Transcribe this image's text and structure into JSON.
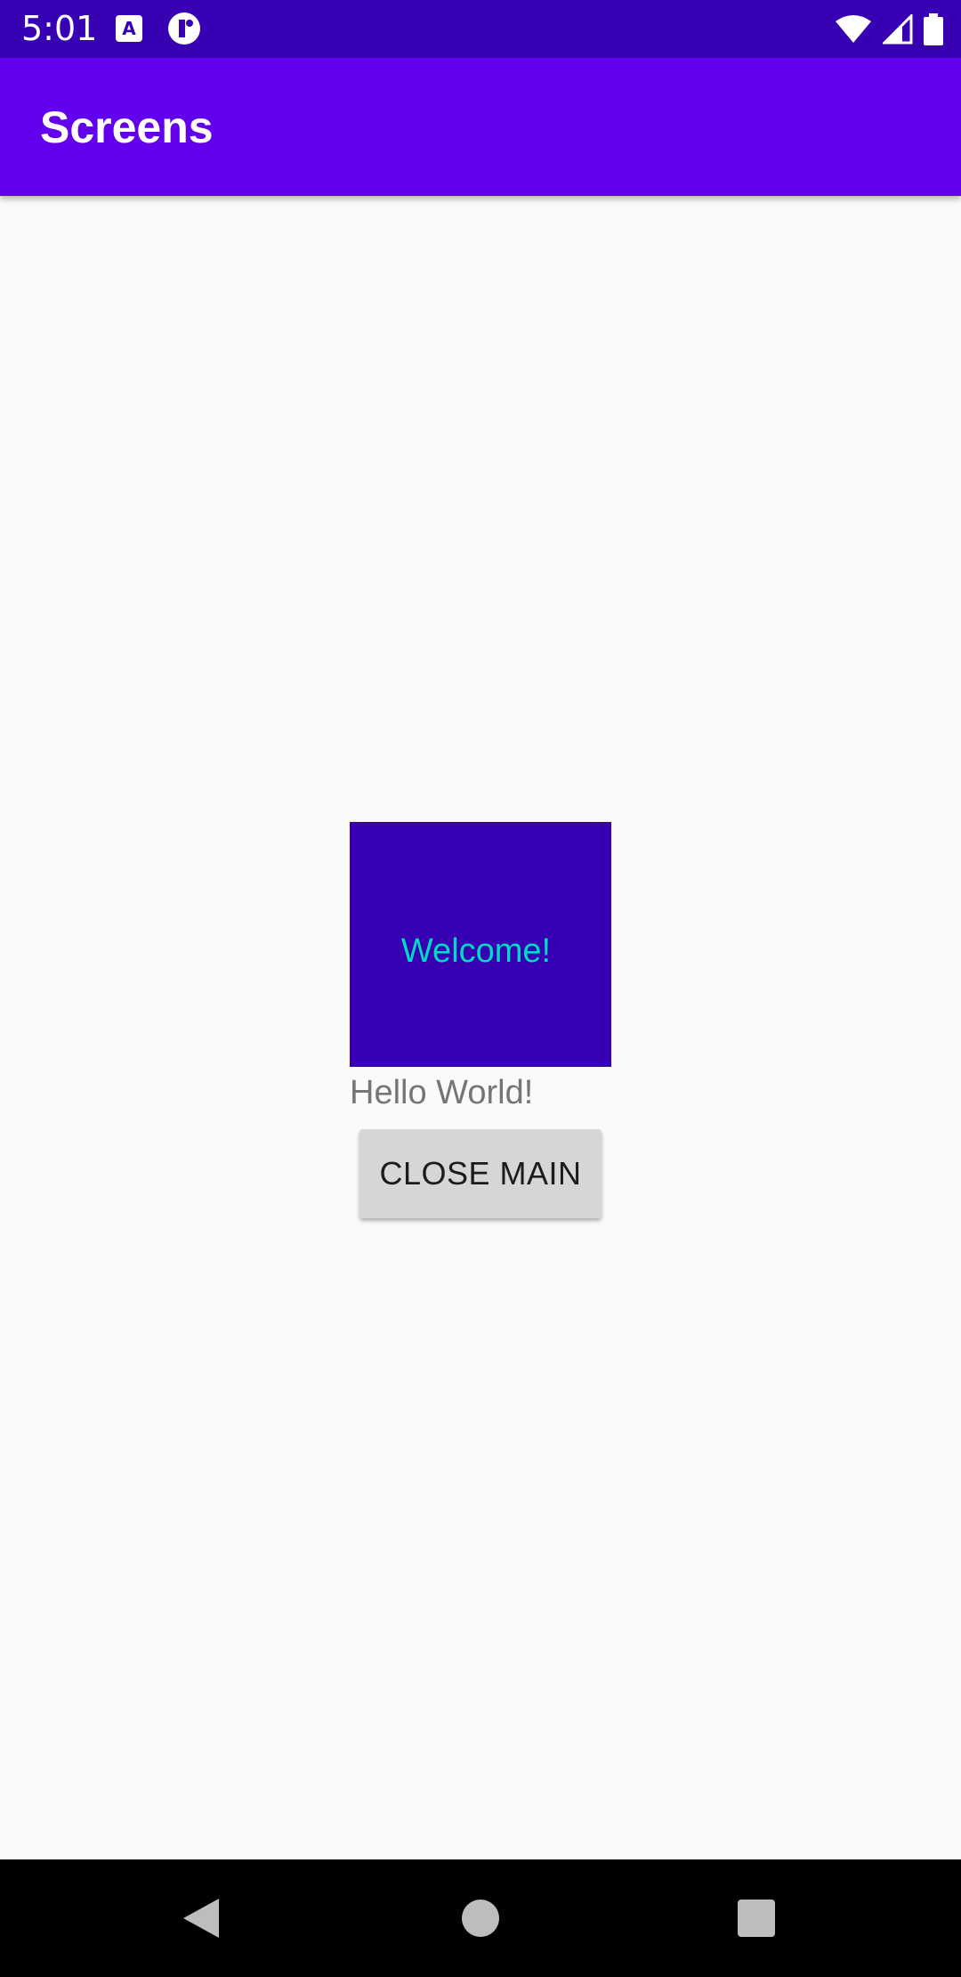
{
  "status_bar": {
    "time": "5:01",
    "notification_icons": [
      "accessibility-a-icon",
      "t-app-icon"
    ],
    "system_icons": [
      "wifi-icon",
      "cell-signal-icon",
      "battery-icon"
    ],
    "background_color": "#3700b3"
  },
  "app_bar": {
    "title": "Screens",
    "background_color": "#6200ee"
  },
  "main": {
    "welcome_box": {
      "text": "Welcome!",
      "background_color": "#3700b3",
      "text_color": "#03dac5"
    },
    "hello_text": "Hello World!",
    "close_button_label": "CLOSE MAIN"
  },
  "nav_bar": {
    "buttons": [
      "back-icon",
      "home-icon",
      "recents-icon"
    ]
  }
}
